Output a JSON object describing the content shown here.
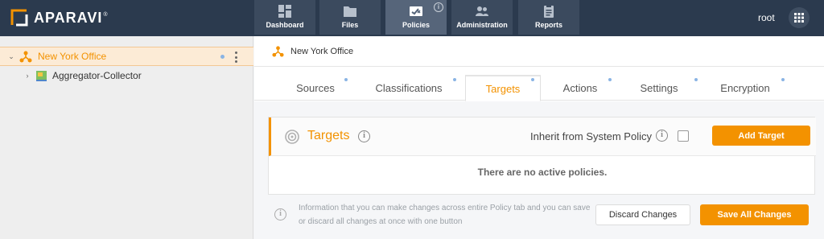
{
  "app": {
    "logo_text": "APARAVI",
    "logo_mark": "®"
  },
  "nav": [
    {
      "label": "Dashboard",
      "icon": "dashboard-icon"
    },
    {
      "label": "Files",
      "icon": "folder-icon"
    },
    {
      "label": "Policies",
      "icon": "policies-icon",
      "active": true
    },
    {
      "label": "Administration",
      "icon": "users-icon"
    },
    {
      "label": "Reports",
      "icon": "clipboard-icon"
    }
  ],
  "header": {
    "user": "root"
  },
  "sidebar": {
    "items": [
      {
        "label": "New York Office",
        "icon": "network-node-icon",
        "selected": true,
        "expanded": true
      },
      {
        "label": "Aggregator-Collector",
        "icon": "aggregator-icon",
        "selected": false,
        "expanded": false
      }
    ]
  },
  "breadcrumb": {
    "label": "New York Office"
  },
  "tabs": [
    {
      "label": "Sources"
    },
    {
      "label": "Classifications"
    },
    {
      "label": "Targets",
      "active": true
    },
    {
      "label": "Actions"
    },
    {
      "label": "Settings"
    },
    {
      "label": "Encryption"
    }
  ],
  "targets_panel": {
    "title": "Targets",
    "inherit_label": "Inherit from System Policy",
    "inherit_checked": false,
    "add_button": "Add Target",
    "empty_message": "There are no active policies."
  },
  "footer": {
    "info_text": "Information that you can make changes across entire Policy tab and you can save or discard all changes at once with one button",
    "discard_label": "Discard Changes",
    "save_label": "Save All Changes"
  },
  "colors": {
    "accent": "#f39200",
    "topbar": "#2b3a4e",
    "nav_active": "#56657a",
    "status_dot": "#8ab4e4"
  }
}
